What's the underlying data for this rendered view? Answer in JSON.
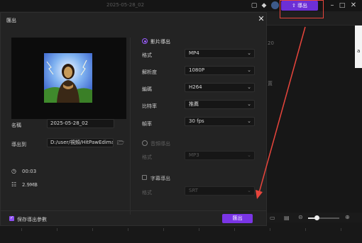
{
  "app": {
    "project_title": "2025-05-28_02",
    "export_button_label": "導出",
    "right_panel_peek_1": "20",
    "right_panel_peek_2": "a",
    "right_panel_peek_3": "置"
  },
  "dialog": {
    "title": "匯出",
    "name_label": "名稱",
    "name_value": "2025-05-28_02",
    "export_to_label": "導出到",
    "export_path": "D:/user/視頻/HitPawEdimakor",
    "duration": "00:03",
    "file_size": "2.9MB",
    "video_export": {
      "label": "影片導出",
      "selected": true,
      "format_label": "格式",
      "format_value": "MP4",
      "resolution_label": "解析度",
      "resolution_value": "1080P",
      "encoder_label": "編碼",
      "encoder_value": "H264",
      "bitrate_label": "比特率",
      "bitrate_value": "推薦",
      "framerate_label": "幀率",
      "framerate_value": "30  fps"
    },
    "audio_export": {
      "label": "音頻導出",
      "selected": false,
      "format_label": "格式",
      "format_value": "MP3"
    },
    "subtitle_export": {
      "label": "字幕導出",
      "checked": false,
      "format_label": "格式",
      "format_value": "SRT"
    },
    "save_params_label": "保存導出參數",
    "save_params_checked": true,
    "export_button_label": "匯出"
  },
  "colors": {
    "accent": "#7a35e6",
    "annotation": "#e8453c"
  }
}
